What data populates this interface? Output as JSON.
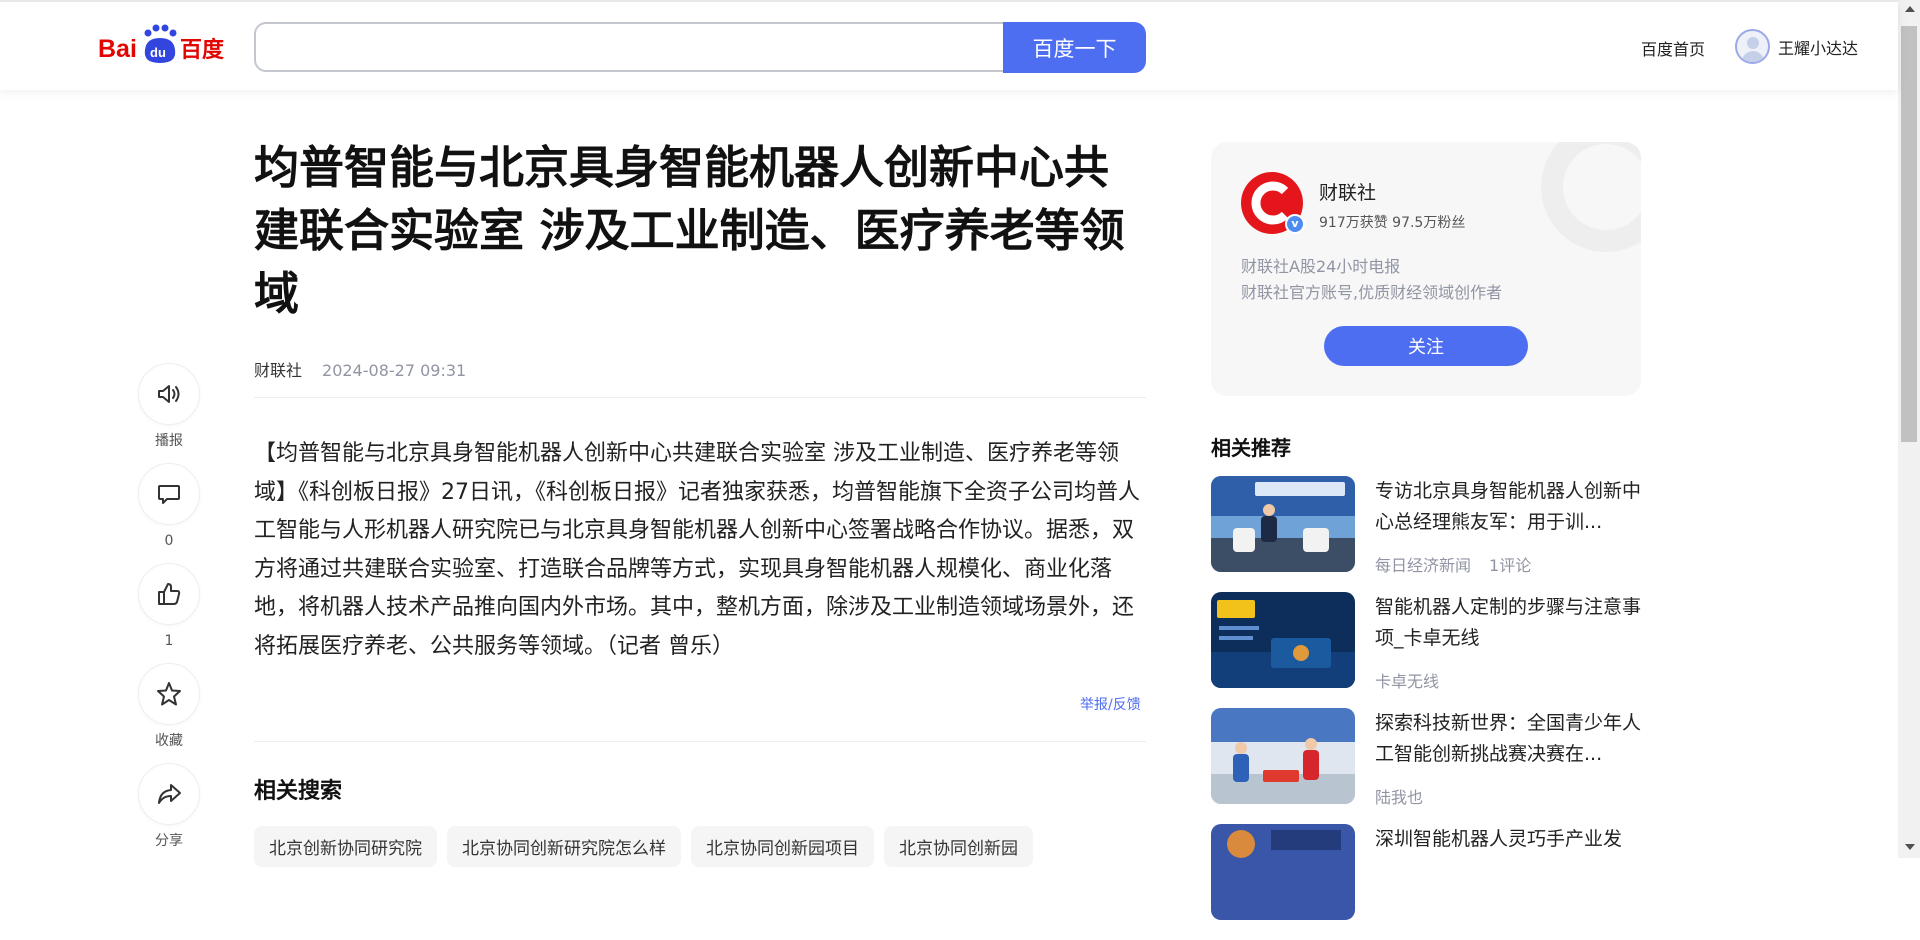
{
  "header": {
    "logo_text": "Bai du 百度",
    "search_value": "",
    "search_button": "百度一下",
    "home_link": "百度首页",
    "user_name": "王耀小达达"
  },
  "actions": [
    {
      "icon": "speaker-icon",
      "label": "播报"
    },
    {
      "icon": "comment-icon",
      "label": "0"
    },
    {
      "icon": "thumbs-up-icon",
      "label": "1"
    },
    {
      "icon": "star-icon",
      "label": "收藏"
    },
    {
      "icon": "share-icon",
      "label": "分享"
    }
  ],
  "article": {
    "title": "均普智能与北京具身智能机器人创新中心共建联合实验室 涉及工业制造、医疗养老等领域",
    "source": "财联社",
    "date": "2024-08-27 09:31",
    "content": "【均普智能与北京具身智能机器人创新中心共建联合实验室 涉及工业制造、医疗养老等领域】《科创板日报》27日讯，《科创板日报》记者独家获悉，均普智能旗下全资子公司均普人工智能与人形机器人研究院已与北京具身智能机器人创新中心签署战略合作协议。据悉，双方将通过共建联合实验室、打造联合品牌等方式，实现具身智能机器人规模化、商业化落地，将机器人技术产品推向国内外市场。其中，整机方面，除涉及工业制造领域场景外，还将拓展医疗养老、公共服务等领域。（记者 曾乐）",
    "report_link": "举报/反馈"
  },
  "related_search": {
    "title": "相关搜索",
    "tags": [
      "北京创新协同研究院",
      "北京协同创新研究院怎么样",
      "北京协同创新园项目",
      "北京协同创新园"
    ]
  },
  "author": {
    "name": "财联社",
    "stats": "917万获赞 97.5万粉丝",
    "desc_line1": "财联社A股24小时电报",
    "desc_line2": "财联社官方账号,优质财经领域创作者",
    "follow": "关注",
    "verify_mark": "v",
    "brand_color": "#e5161b"
  },
  "recommend": {
    "title": "相关推荐",
    "items": [
      {
        "title": "专访北京具身智能机器人创新中心总经理熊友军：用于训...",
        "source": "每日经济新闻",
        "comments": "1评论"
      },
      {
        "title": "智能机器人定制的步骤与注意事项_卡卓无线",
        "source": "卡卓无线",
        "comments": ""
      },
      {
        "title": "探索科技新世界：全国青少年人工智能创新挑战赛决赛在...",
        "source": "陆我也",
        "comments": ""
      },
      {
        "title": "深圳智能机器人灵巧手产业发",
        "source": "",
        "comments": ""
      }
    ]
  },
  "colors": {
    "accent": "#4e6ef2",
    "meta_gray": "#9195a3"
  }
}
